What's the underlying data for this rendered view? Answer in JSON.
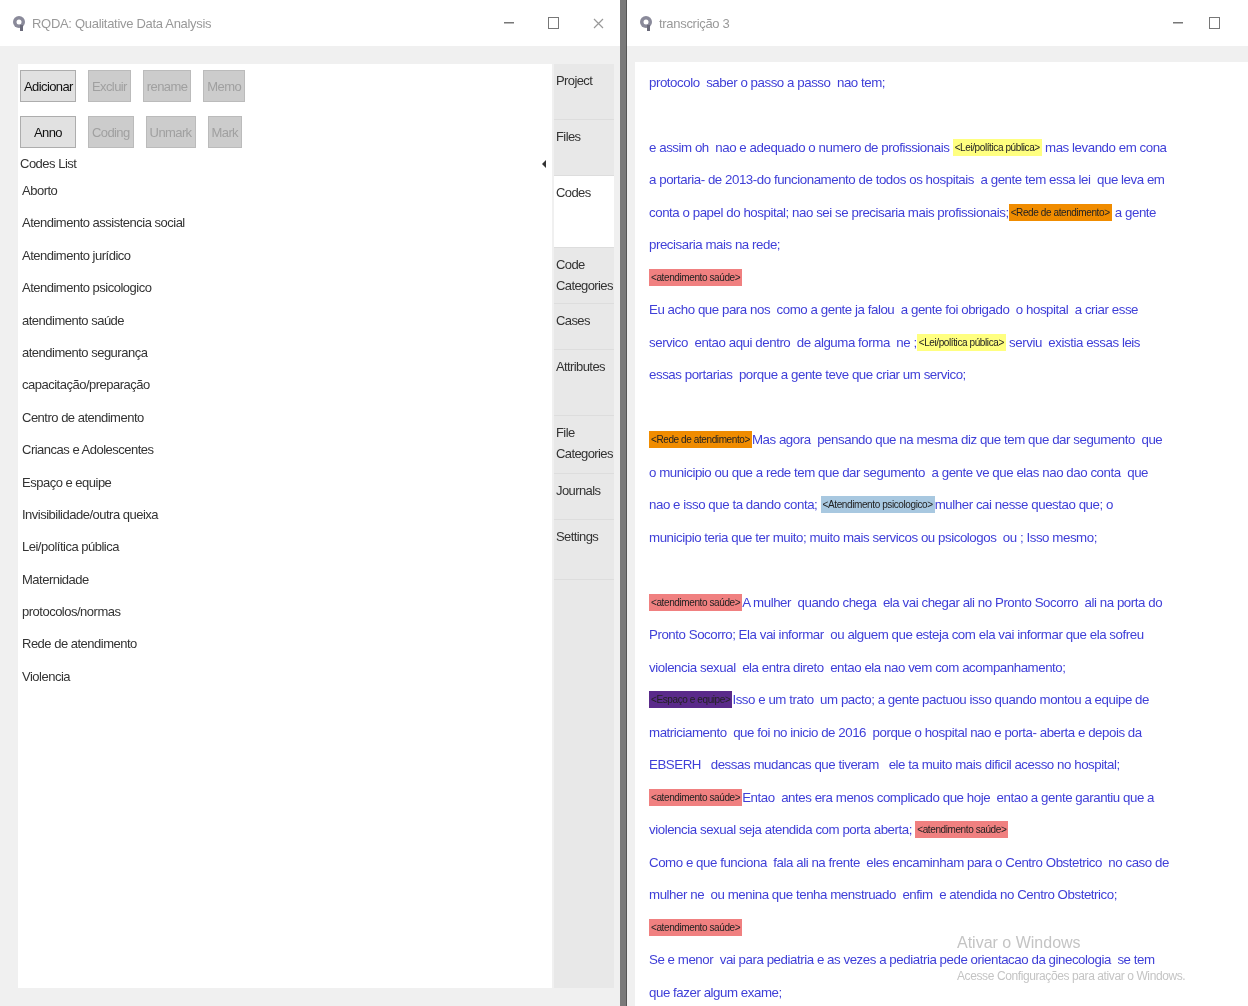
{
  "main_window": {
    "title": "RQDA: Qualitative Data Analysis",
    "button_rows": [
      [
        {
          "label": "Adicionar",
          "disabled": false
        },
        {
          "label": "Excluir",
          "disabled": true
        },
        {
          "label": "rename",
          "disabled": true
        },
        {
          "label": "Memo",
          "disabled": true
        }
      ],
      [
        {
          "label": "Anno",
          "disabled": false
        },
        {
          "label": "Coding",
          "disabled": true
        },
        {
          "label": "Unmark",
          "disabled": true
        },
        {
          "label": "Mark",
          "disabled": true
        }
      ]
    ],
    "list_title": "Codes List",
    "codes": [
      "Aborto",
      "Atendimento assistencia social",
      "Atendimento jurídico",
      "Atendimento psicologico",
      "atendimento saúde",
      "atendimento segurança",
      "capacitação/preparação",
      "Centro de atendimento",
      "Criancas e Adolescentes",
      "Espaço e equipe",
      "Invisibilidade/outra queixa",
      "Lei/política pública",
      "Maternidade",
      "protocolos/normas",
      "Rede de atendimento",
      "Violencia"
    ],
    "tabs": [
      {
        "label": "Project",
        "selected": false
      },
      {
        "label": "Files",
        "selected": false
      },
      {
        "label": "Codes",
        "selected": true
      },
      {
        "label": "Code Categories",
        "selected": false
      },
      {
        "label": "Cases",
        "selected": false
      },
      {
        "label": "Attributes",
        "selected": false
      },
      {
        "label": "File Categories",
        "selected": false
      },
      {
        "label": "Journals",
        "selected": false
      },
      {
        "label": "Settings",
        "selected": false
      }
    ]
  },
  "text_window": {
    "title": "transcrição 3",
    "lines": [
      {
        "segments": [
          {
            "kind": "text",
            "text": "protocolo  saber o passo a passo  nao tem;"
          }
        ]
      },
      {
        "gap_before": true,
        "segments": [
          {
            "kind": "text",
            "text": "e assim oh  nao e adequado o numero de profissionais "
          },
          {
            "kind": "code",
            "text": "<Lei/política pública>",
            "color": "#ffff80"
          },
          {
            "kind": "text",
            "text": " mas levando em cona"
          }
        ]
      },
      {
        "segments": [
          {
            "kind": "text",
            "text": "a portaria- de 2013-do funcionamento de todos os hospitais  a gente tem essa lei  que leva em"
          }
        ]
      },
      {
        "segments": [
          {
            "kind": "text",
            "text": "conta o papel do hospital; nao sei se precisaria mais profissionais;"
          },
          {
            "kind": "code",
            "text": "<Rede de atendimento>",
            "color": "#f08c00"
          },
          {
            "kind": "text",
            "text": " a gente"
          }
        ]
      },
      {
        "segments": [
          {
            "kind": "text",
            "text": "precisaria mais na rede;"
          }
        ]
      },
      {
        "segments": [
          {
            "kind": "code",
            "text": "<atendimento saúde>",
            "color": "#f08080"
          }
        ]
      },
      {
        "segments": [
          {
            "kind": "text",
            "text": "Eu acho que para nos  como a gente ja falou  a gente foi obrigado  o hospital  a criar esse"
          }
        ]
      },
      {
        "segments": [
          {
            "kind": "text",
            "text": "servico  entao aqui dentro  de alguma forma  ne ;"
          },
          {
            "kind": "code",
            "text": "<Lei/política pública>",
            "color": "#ffff80"
          },
          {
            "kind": "text",
            "text": " serviu  existia essas leis"
          }
        ]
      },
      {
        "segments": [
          {
            "kind": "text",
            "text": "essas portarias  porque a gente teve que criar um servico;"
          }
        ]
      },
      {
        "gap_before": true,
        "segments": [
          {
            "kind": "code",
            "text": "<Rede de atendimento>",
            "color": "#f08c00"
          },
          {
            "kind": "text",
            "text": "Mas agora  pensando que na mesma diz que tem que dar segumento  que"
          }
        ]
      },
      {
        "segments": [
          {
            "kind": "text",
            "text": "o municipio ou que a rede tem que dar segumento  a gente ve que elas nao dao conta  que"
          }
        ]
      },
      {
        "segments": [
          {
            "kind": "text",
            "text": "nao e isso que ta dando conta; "
          },
          {
            "kind": "code",
            "text": "<Atendimento psicologico>",
            "color": "#a8c8e0"
          },
          {
            "kind": "text",
            "text": "mulher cai nesse questao que; o"
          }
        ]
      },
      {
        "segments": [
          {
            "kind": "text",
            "text": "municipio teria que ter muito; muito mais servicos ou psicologos  ou ; Isso mesmo;"
          }
        ]
      },
      {
        "gap_before": true,
        "segments": [
          {
            "kind": "code",
            "text": "<atendimento saúde>",
            "color": "#f08080"
          },
          {
            "kind": "text",
            "text": "A mulher  quando chega  ela vai chegar ali no Pronto Socorro  ali na porta do"
          }
        ]
      },
      {
        "segments": [
          {
            "kind": "text",
            "text": "Pronto Socorro; Ela vai informar  ou alguem que esteja com ela vai informar que ela sofreu"
          }
        ]
      },
      {
        "segments": [
          {
            "kind": "text",
            "text": "violencia sexual  ela entra direto  entao ela nao vem com acompanhamento;"
          }
        ]
      },
      {
        "segments": [
          {
            "kind": "code",
            "text": "<Espaço e equipe>",
            "color": "#5a2a8a"
          },
          {
            "kind": "text",
            "text": "Isso e um trato  um pacto; a gente pactuou isso quando montou a equipe de"
          }
        ]
      },
      {
        "segments": [
          {
            "kind": "text",
            "text": "matriciamento  que foi no inicio de 2016  porque o hospital nao e porta- aberta e depois da"
          }
        ]
      },
      {
        "segments": [
          {
            "kind": "text",
            "text": "EBSERH   dessas mudancas que tiveram   ele ta muito mais dificil acesso no hospital;"
          }
        ]
      },
      {
        "segments": [
          {
            "kind": "code",
            "text": "<atendimento saúde>",
            "color": "#f08080"
          },
          {
            "kind": "text",
            "text": "Entao  antes era menos complicado que hoje  entao a gente garantiu que a"
          }
        ]
      },
      {
        "segments": [
          {
            "kind": "text",
            "text": "violencia sexual seja atendida com porta aberta; "
          },
          {
            "kind": "code",
            "text": "<atendimento saúde>",
            "color": "#f08080"
          }
        ]
      },
      {
        "segments": [
          {
            "kind": "text",
            "text": "Como e que funciona  fala ali na frente  eles encaminham para o Centro Obstetrico  no caso de"
          }
        ]
      },
      {
        "segments": [
          {
            "kind": "text",
            "text": "mulher ne  ou menina que tenha menstruado  enfim  e atendida no Centro Obstetrico;"
          }
        ]
      },
      {
        "segments": [
          {
            "kind": "code",
            "text": "<atendimento saúde>",
            "color": "#f08080"
          }
        ]
      },
      {
        "segments": [
          {
            "kind": "text",
            "text": "Se e menor  vai para pediatria e as vezes a pediatria pede orientacao da ginecologia  se tem"
          }
        ]
      },
      {
        "segments": [
          {
            "kind": "text",
            "text": "que fazer algum exame;"
          }
        ]
      }
    ]
  },
  "os_notice": {
    "title": "Ativar o Windows",
    "subtitle": "Acesse Configurações para ativar o Windows."
  }
}
